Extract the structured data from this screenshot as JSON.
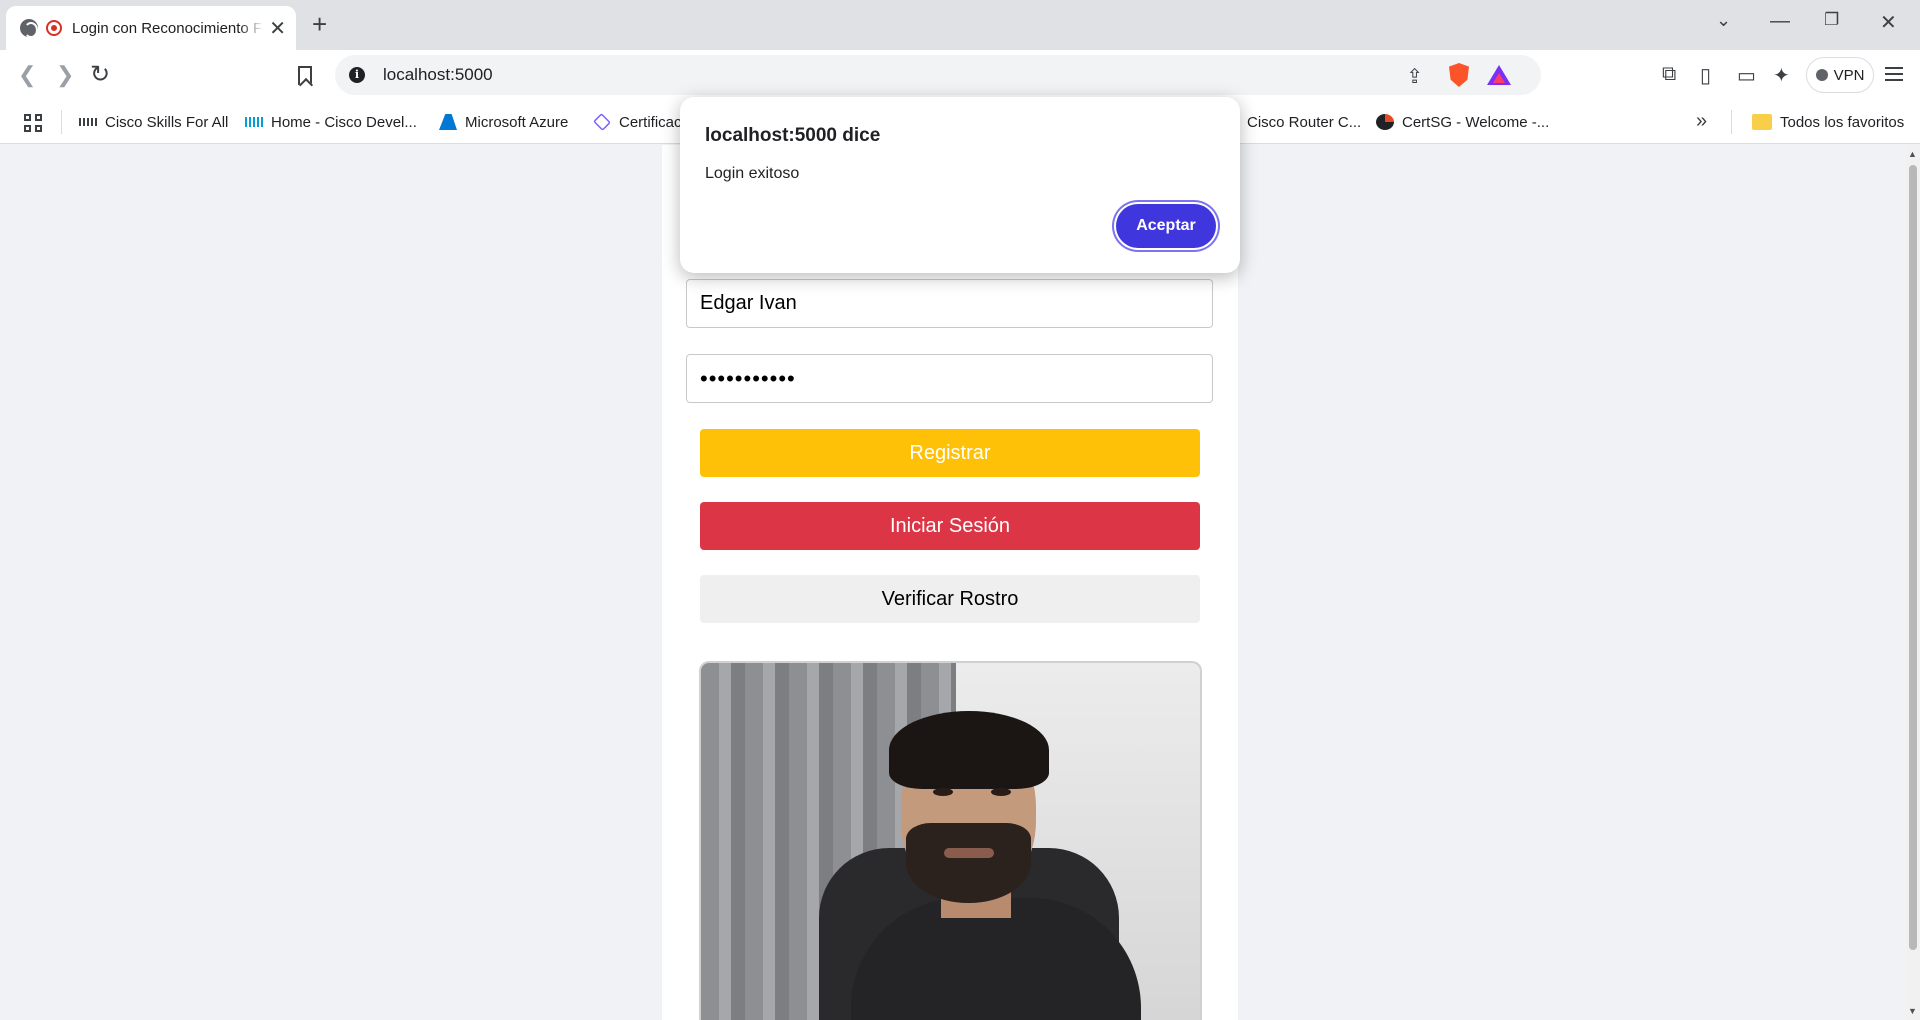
{
  "browser": {
    "tab": {
      "title": "Login con Reconocimiento Facial"
    },
    "address": {
      "url": "localhost:5000"
    },
    "vpn_label": "VPN",
    "bookmarks": [
      {
        "label": "Cisco Skills For All",
        "icon": "cisco-icon"
      },
      {
        "label": "Home - Cisco Devel...",
        "icon": "cisco-devnet-icon"
      },
      {
        "label": "Microsoft Azure",
        "icon": "azure-icon"
      },
      {
        "label": "Certificac",
        "icon": "cube-icon"
      },
      {
        "label": "Cisco Router C...",
        "icon": "cisco-icon"
      },
      {
        "label": "CertSG - Welcome -...",
        "icon": "certsg-icon"
      }
    ],
    "all_bookmarks_label": "Todos los favoritos"
  },
  "form": {
    "username_value": "Edgar Ivan",
    "password_value": "•••••••••••",
    "register_label": "Registrar",
    "login_label": "Iniciar Sesión",
    "verify_label": "Verificar Rostro"
  },
  "dialog": {
    "title": "localhost:5000 dice",
    "message": "Login exitoso",
    "ok_label": "Aceptar"
  },
  "colors": {
    "register": "#ffc107",
    "login": "#dc3545",
    "verify": "#efefef",
    "dialog_button": "#3f36dd"
  }
}
